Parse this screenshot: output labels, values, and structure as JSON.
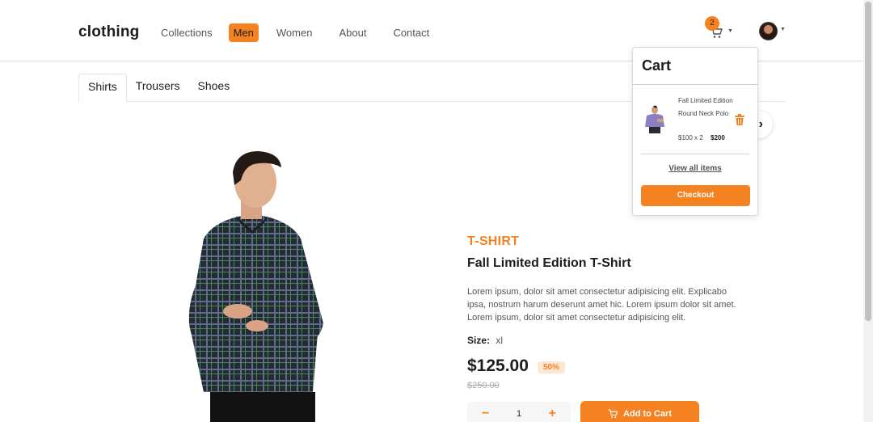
{
  "header": {
    "logo": "clothing",
    "nav": [
      {
        "label": "Collections"
      },
      {
        "label": "Men"
      },
      {
        "label": "Women"
      },
      {
        "label": "About"
      },
      {
        "label": "Contact"
      }
    ],
    "active_nav": "Men",
    "cart_count": "2",
    "accent": "#f58220"
  },
  "tabs": [
    {
      "label": "Shirts"
    },
    {
      "label": "Trousers"
    },
    {
      "label": "Shoes"
    }
  ],
  "product": {
    "category": "T-SHIRT",
    "title": "Fall Limited Edition T-Shirt",
    "description": "Lorem ipsum, dolor sit amet consectetur adipisicing elit. Explicabo ipsa, nostrum harum deserunt amet hic. Lorem ipsum dolor sit amet. Lorem ipsum, dolor sit amet consectetur adipisicing elit.",
    "size_label": "Size:",
    "size_value": "xl",
    "price": "$125.00",
    "discount": "50%",
    "old_price": "$250.00",
    "quantity": "1",
    "minus": "−",
    "plus": "+",
    "add_to_cart": "Add to Cart"
  },
  "cart": {
    "title": "Cart",
    "item_name": "Fall Limited Edition Round Neck Polo",
    "item_qty": "$100 x 2",
    "item_total": "$200",
    "view_all": "View all items",
    "checkout": "Checkout"
  },
  "icons": {
    "cart": "cart-icon",
    "trash": "trash-icon",
    "next": "chevron-right-icon",
    "caret": "caret-down-icon"
  }
}
